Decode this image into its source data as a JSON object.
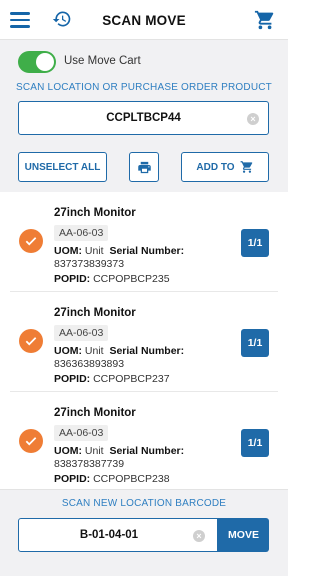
{
  "header": {
    "title": "SCAN MOVE",
    "menu_icon": "hamburger-icon",
    "history_icon": "history-icon",
    "cart_icon": "cart-icon"
  },
  "toggle": {
    "label": "Use Move Cart",
    "on": true,
    "color": "#3fae49"
  },
  "scan": {
    "heading": "SCAN LOCATION OR PURCHASE ORDER PRODUCT",
    "value": "CCPLTBCP44"
  },
  "actions": {
    "unselect_label": "UNSELECT ALL",
    "print_icon": "printer-icon",
    "add_to_label": "ADD TO"
  },
  "items": [
    {
      "name": "27inch Monitor",
      "location": "AA-06-03",
      "uom_label": "UOM:",
      "uom": "Unit",
      "serial_label": "Serial Number:",
      "serial": "837373839373",
      "popid_label": "POPID:",
      "popid": "CCPOPBCP235",
      "qty": "1/1"
    },
    {
      "name": "27inch Monitor",
      "location": "AA-06-03",
      "uom_label": "UOM:",
      "uom": "Unit",
      "serial_label": "Serial Number:",
      "serial": "836363893893",
      "popid_label": "POPID:",
      "popid": "CCPOPBCP237",
      "qty": "1/1"
    },
    {
      "name": "27inch Monitor",
      "location": "AA-06-03",
      "uom_label": "UOM:",
      "uom": "Unit",
      "serial_label": "Serial Number:",
      "serial": "838378387739",
      "popid_label": "POPID:",
      "popid": "CCPOPBCP238",
      "qty": "1/1"
    }
  ],
  "new_location": {
    "heading": "SCAN NEW LOCATION BARCODE",
    "value": "B-01-04-01",
    "move_label": "MOVE"
  },
  "colors": {
    "accent": "#1f6aa8",
    "check": "#ef7d35",
    "toggle": "#3fae49"
  }
}
